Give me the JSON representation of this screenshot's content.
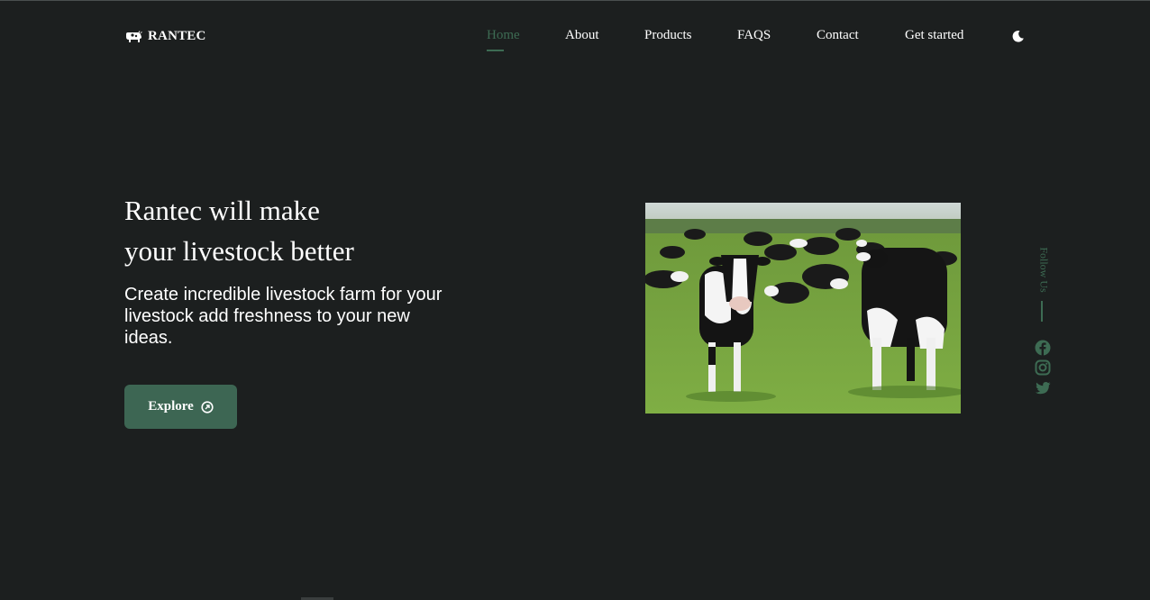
{
  "brand": {
    "name": "RANTEC",
    "icon": "cow-icon"
  },
  "nav": {
    "items": [
      {
        "label": "Home",
        "active": true
      },
      {
        "label": "About",
        "active": false
      },
      {
        "label": "Products",
        "active": false
      },
      {
        "label": "FAQS",
        "active": false
      },
      {
        "label": "Contact",
        "active": false
      },
      {
        "label": "Get started",
        "active": false
      }
    ],
    "theme_toggle_icon": "moon-icon"
  },
  "hero": {
    "title_line1": "Rantec will make",
    "title_line2": "your livestock better",
    "description": "Create incredible livestock farm for your livestock add freshness to your new ideas.",
    "button_label": "Explore",
    "button_icon": "arrow-circle-icon",
    "image": "cows-in-pasture"
  },
  "social": {
    "follow_label": "Follow Us",
    "icons": [
      "facebook-icon",
      "instagram-icon",
      "twitter-icon"
    ]
  },
  "colors": {
    "background": "#1c1f1f",
    "accent": "#3d6b53",
    "button": "#3d6653",
    "text": "#ffffff"
  }
}
